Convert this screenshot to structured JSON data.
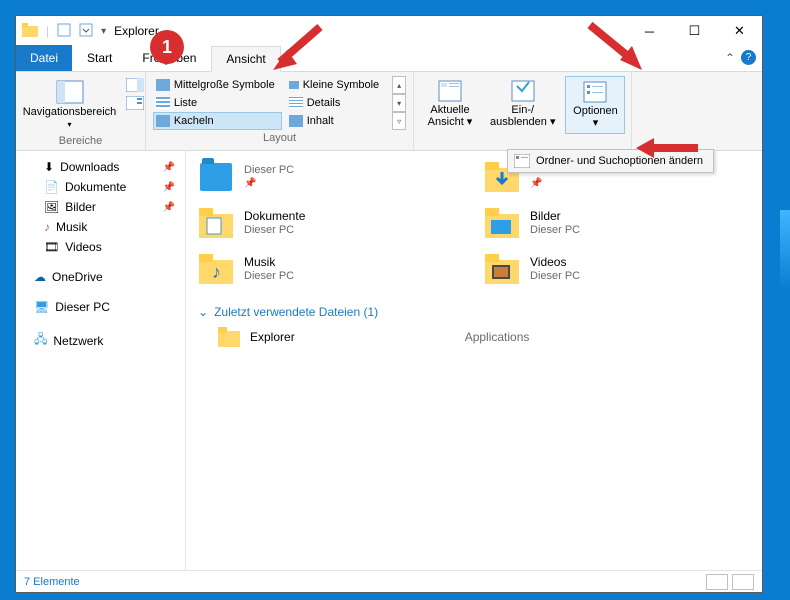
{
  "window": {
    "title": "Explorer"
  },
  "tabs": {
    "datei": "Datei",
    "start": "Start",
    "freigeben": "Freigeben",
    "ansicht": "Ansicht"
  },
  "ribbon": {
    "bereiche": {
      "title": "Bereiche",
      "navigationsbereich": "Navigationsbereich"
    },
    "layout": {
      "title": "Layout",
      "mittel": "Mittelgroße Symbole",
      "kleine": "Kleine Symbole",
      "liste": "Liste",
      "details": "Details",
      "kacheln": "Kacheln",
      "inhalt": "Inhalt"
    },
    "aktuelle": "Aktuelle\nAnsicht ▾",
    "einaus": "Ein-/\nausblenden ▾",
    "optionen": "Optionen\n▾",
    "dropdown": "Ordner- und Suchoptionen ändern"
  },
  "nav": {
    "downloads": "Downloads",
    "dokumente": "Dokumente",
    "bilder": "Bilder",
    "musik": "Musik",
    "videos": "Videos",
    "onedrive": "OneDrive",
    "dieserpc": "Dieser PC",
    "netzwerk": "Netzwerk"
  },
  "tiles": {
    "sub": "Dieser PC",
    "dokumente": "Dokumente",
    "bilder": "Bilder",
    "musik": "Musik",
    "videos": "Videos"
  },
  "recent": {
    "head": "Zuletzt verwendete Dateien (1)",
    "explorer": "Explorer",
    "applications": "Applications"
  },
  "status": {
    "count": "7 Elemente"
  },
  "annot": {
    "badge": "1"
  }
}
